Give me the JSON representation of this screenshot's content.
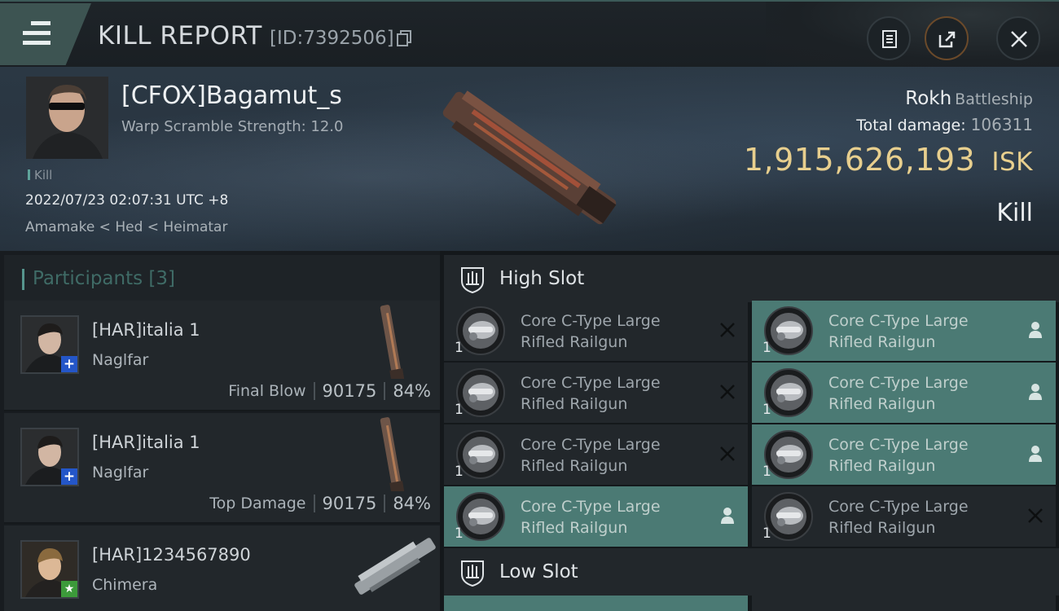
{
  "header": {
    "title": "KILL REPORT",
    "report_id": "[ID:7392506]"
  },
  "victim": {
    "name": "[CFOX]Bagamut_s",
    "warp_scramble": "Warp Scramble Strength: 12.0",
    "tag": "Kill",
    "timestamp": "2022/07/23 02:07:31 UTC +8",
    "location": "Amamake < Hed < Heimatar",
    "ship_name": "Rokh",
    "ship_class": "Battleship",
    "total_damage_label": "Total damage:",
    "total_damage_value": "106311",
    "isk_value": "1,915,626,193",
    "isk_unit": "ISK",
    "result": "Kill"
  },
  "participants": {
    "title": "Participants [3]",
    "items": [
      {
        "name": "[HAR]italia 1",
        "ship": "Naglfar",
        "stat_label": "Final Blow",
        "damage": "90175",
        "percent": "84%",
        "badge": "+"
      },
      {
        "name": "[HAR]italia 1",
        "ship": "Naglfar",
        "stat_label": "Top Damage",
        "damage": "90175",
        "percent": "84%",
        "badge": "+"
      },
      {
        "name": "[HAR]1234567890",
        "ship": "Chimera",
        "stat_label": "",
        "damage": "",
        "percent": "",
        "badge": "★"
      }
    ]
  },
  "slots": {
    "high_slot_label": "High Slot",
    "low_slot_label": "Low Slot",
    "modules": [
      {
        "name_line1": "Core C-Type Large",
        "name_line2": "Rifled Railgun",
        "qty": "1",
        "state": "destroyed"
      },
      {
        "name_line1": "Core C-Type Large",
        "name_line2": "Rifled Railgun",
        "qty": "1",
        "state": "dropped"
      },
      {
        "name_line1": "Core C-Type Large",
        "name_line2": "Rifled Railgun",
        "qty": "1",
        "state": "destroyed"
      },
      {
        "name_line1": "Core C-Type Large",
        "name_line2": "Rifled Railgun",
        "qty": "1",
        "state": "dropped"
      },
      {
        "name_line1": "Core C-Type Large",
        "name_line2": "Rifled Railgun",
        "qty": "1",
        "state": "destroyed"
      },
      {
        "name_line1": "Core C-Type Large",
        "name_line2": "Rifled Railgun",
        "qty": "1",
        "state": "dropped"
      },
      {
        "name_line1": "Core C-Type Large",
        "name_line2": "Rifled Railgun",
        "qty": "1",
        "state": "dropped"
      },
      {
        "name_line1": "Core C-Type Large",
        "name_line2": "Rifled Railgun",
        "qty": "1",
        "state": "destroyed"
      }
    ]
  },
  "colors": {
    "accent_teal": "#4b7a74",
    "isk_gold": "#e8cf8e",
    "badge_blue": "#2456c8",
    "badge_green": "#3c9a3a"
  },
  "icons": {
    "menu": "hamburger-icon",
    "copy": "copy-icon",
    "clipboard": "clipboard-icon",
    "share": "share-icon",
    "close": "close-icon",
    "slot": "shield-slot-icon",
    "destroyed": "x-mark-icon",
    "dropped": "person-icon"
  }
}
